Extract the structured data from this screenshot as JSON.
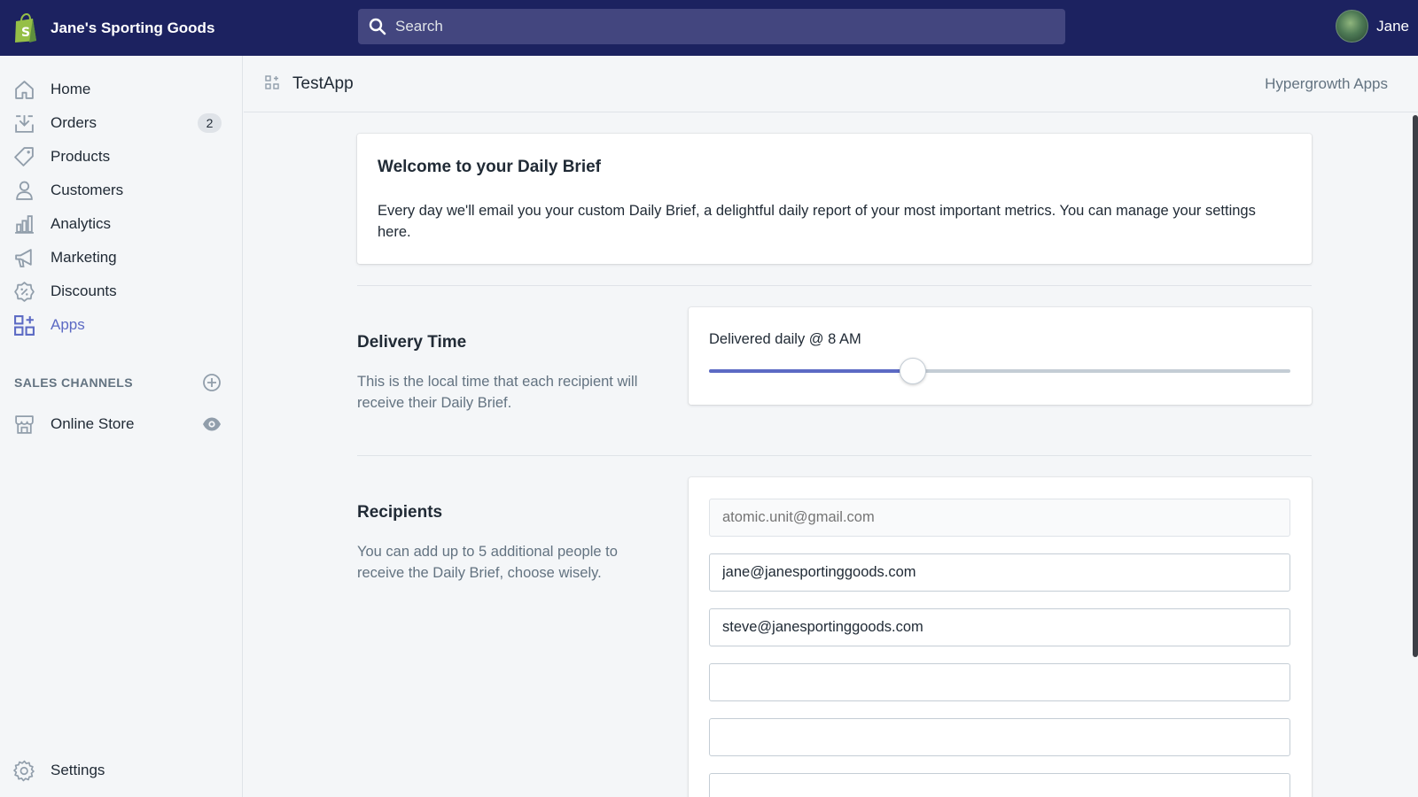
{
  "topbar": {
    "store_name": "Jane's Sporting Goods",
    "search_placeholder": "Search",
    "user_name": "Jane",
    "background_color": "#1c2260"
  },
  "sidebar": {
    "items": [
      {
        "label": "Home",
        "icon": "home-icon"
      },
      {
        "label": "Orders",
        "icon": "orders-icon",
        "badge": "2"
      },
      {
        "label": "Products",
        "icon": "tag-icon"
      },
      {
        "label": "Customers",
        "icon": "person-icon"
      },
      {
        "label": "Analytics",
        "icon": "bar-chart-icon"
      },
      {
        "label": "Marketing",
        "icon": "megaphone-icon"
      },
      {
        "label": "Discounts",
        "icon": "discount-icon"
      },
      {
        "label": "Apps",
        "icon": "apps-icon",
        "active": true
      }
    ],
    "sales_channels_label": "SALES CHANNELS",
    "channels": [
      {
        "label": "Online Store",
        "icon": "store-icon"
      }
    ],
    "settings_label": "Settings",
    "accent_color": "#5c6ac4"
  },
  "header": {
    "app_title": "TestApp",
    "developer_link": "Hypergrowth Apps"
  },
  "welcome": {
    "title": "Welcome to your Daily Brief",
    "body": "Every day we'll email you your custom Daily Brief, a delightful daily report of your most important metrics. You can manage your settings here."
  },
  "delivery": {
    "title": "Delivery Time",
    "description": "This is the local time that each recipient will receive their Daily Brief.",
    "label": "Delivered daily @ 8 AM",
    "slider_fraction": 0.35
  },
  "recipients": {
    "title": "Recipients",
    "description": "You can add up to 5 additional people to receive the Daily Brief, choose wisely.",
    "primary_placeholder": "atomic.unit@gmail.com",
    "emails": [
      "jane@janesportinggoods.com",
      "steve@janesportinggoods.com",
      "",
      "",
      ""
    ]
  }
}
